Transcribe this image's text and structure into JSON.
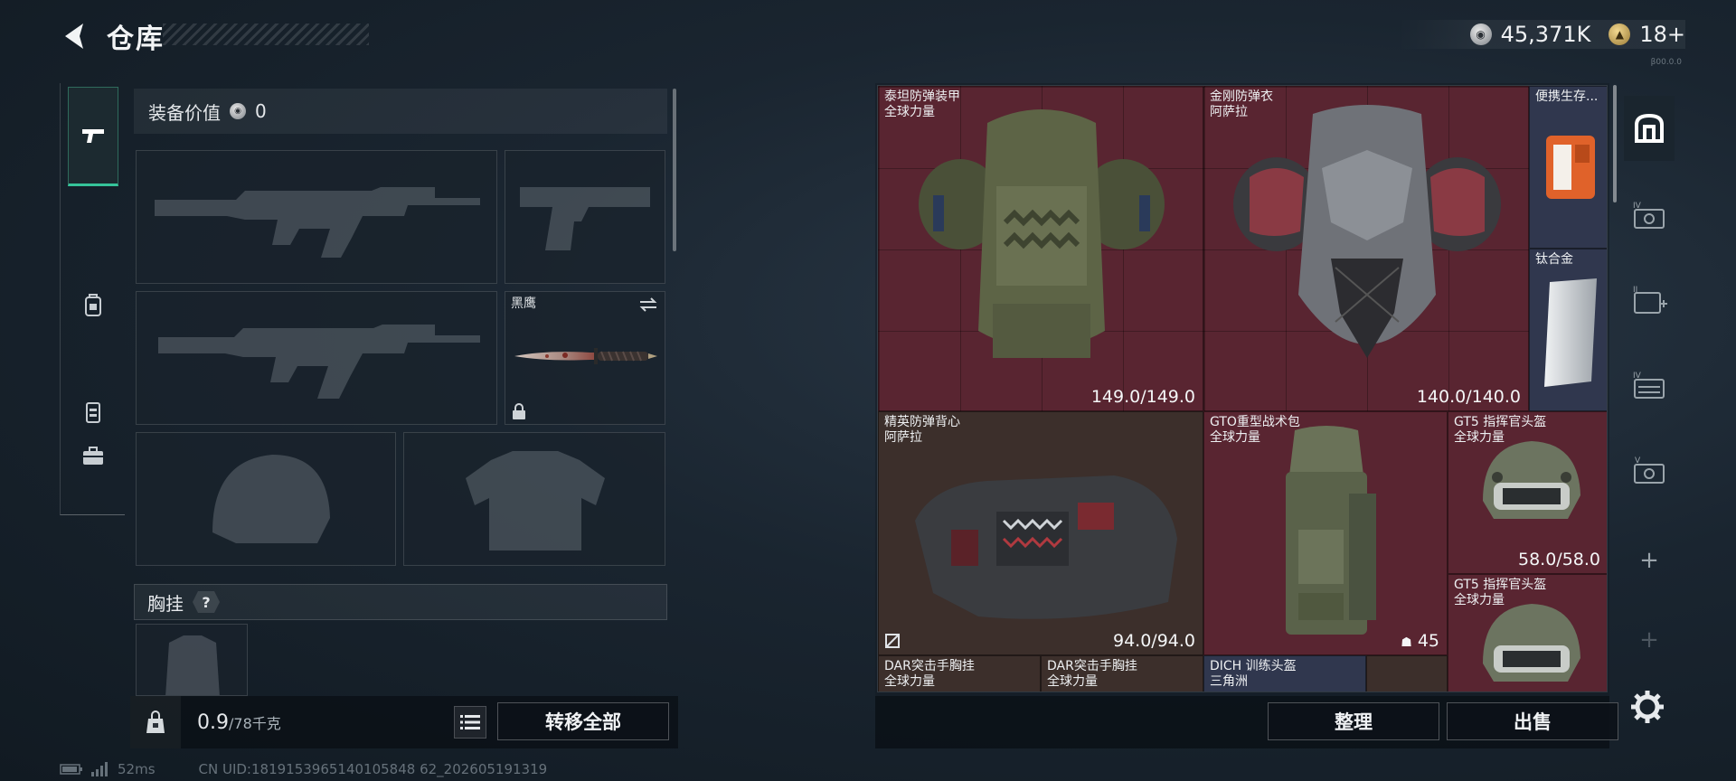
{
  "header": {
    "title": "仓库",
    "silver_amount": "45,371K",
    "gold_amount": "18+",
    "build_label": "β00.0.0"
  },
  "left_panel": {
    "equip_value_label": "装备价值",
    "equip_value": "0",
    "melee_slot_name": "黑鹰",
    "chest_rig_label": "胸挂",
    "help_glyph": "?",
    "weight_current": "0.9",
    "weight_max": "/78千克",
    "transfer_all_label": "转移全部"
  },
  "rail": {
    "items": [
      "pistol-icon",
      "backpack-icon",
      "chest-rig-icon",
      "case-icon"
    ]
  },
  "grid": {
    "items": [
      {
        "name": "泰坦防弹装甲",
        "sub": "全球力量",
        "durability": "149.0/149.0",
        "rarity_color": "#592531"
      },
      {
        "name": "金刚防弹衣",
        "sub": "阿萨拉",
        "durability": "140.0/140.0",
        "rarity_color": "#592531"
      },
      {
        "name": "便携生存...",
        "sub": "",
        "durability": "",
        "rarity_color": "#30374e"
      },
      {
        "name": "钛合金",
        "sub": "",
        "durability": "",
        "rarity_color": "#30374e"
      },
      {
        "name": "精英防弹背心",
        "sub": "阿萨拉",
        "durability": "94.0/94.0",
        "rarity_color": "#3c2f2b"
      },
      {
        "name": "GTO重型战术包",
        "sub": "全球力量",
        "durability": "45",
        "rarity_color": "#592531"
      },
      {
        "name": "GT5 指挥官头盔",
        "sub": "全球力量",
        "durability": "58.0/58.0",
        "rarity_color": "#592531"
      },
      {
        "name": "GT5 指挥官头盔",
        "sub": "全球力量",
        "durability": "",
        "rarity_color": "#592531"
      },
      {
        "name": "DAR突击手胸挂",
        "sub": "全球力量",
        "durability": "",
        "rarity_color": "#3c2f2b"
      },
      {
        "name": "DAR突击手胸挂",
        "sub": "全球力量",
        "durability": "",
        "rarity_color": "#3c2f2b"
      },
      {
        "name": "DICH 训练头盔",
        "sub": "三角洲",
        "durability": "",
        "rarity_color": "#30374e"
      }
    ],
    "organize_label": "整理",
    "sell_label": "出售"
  },
  "side_tools": {
    "items": [
      "safe-box-icon",
      "case-iv-icon",
      "case-ii-plus-icon",
      "case-iv-b-icon",
      "case-v-icon",
      "add-slot-icon",
      "add-slot-icon"
    ],
    "plus": "+"
  },
  "status": {
    "ping": "52ms",
    "uid": "CN UID:1819153965140105848 62_202605191319"
  }
}
